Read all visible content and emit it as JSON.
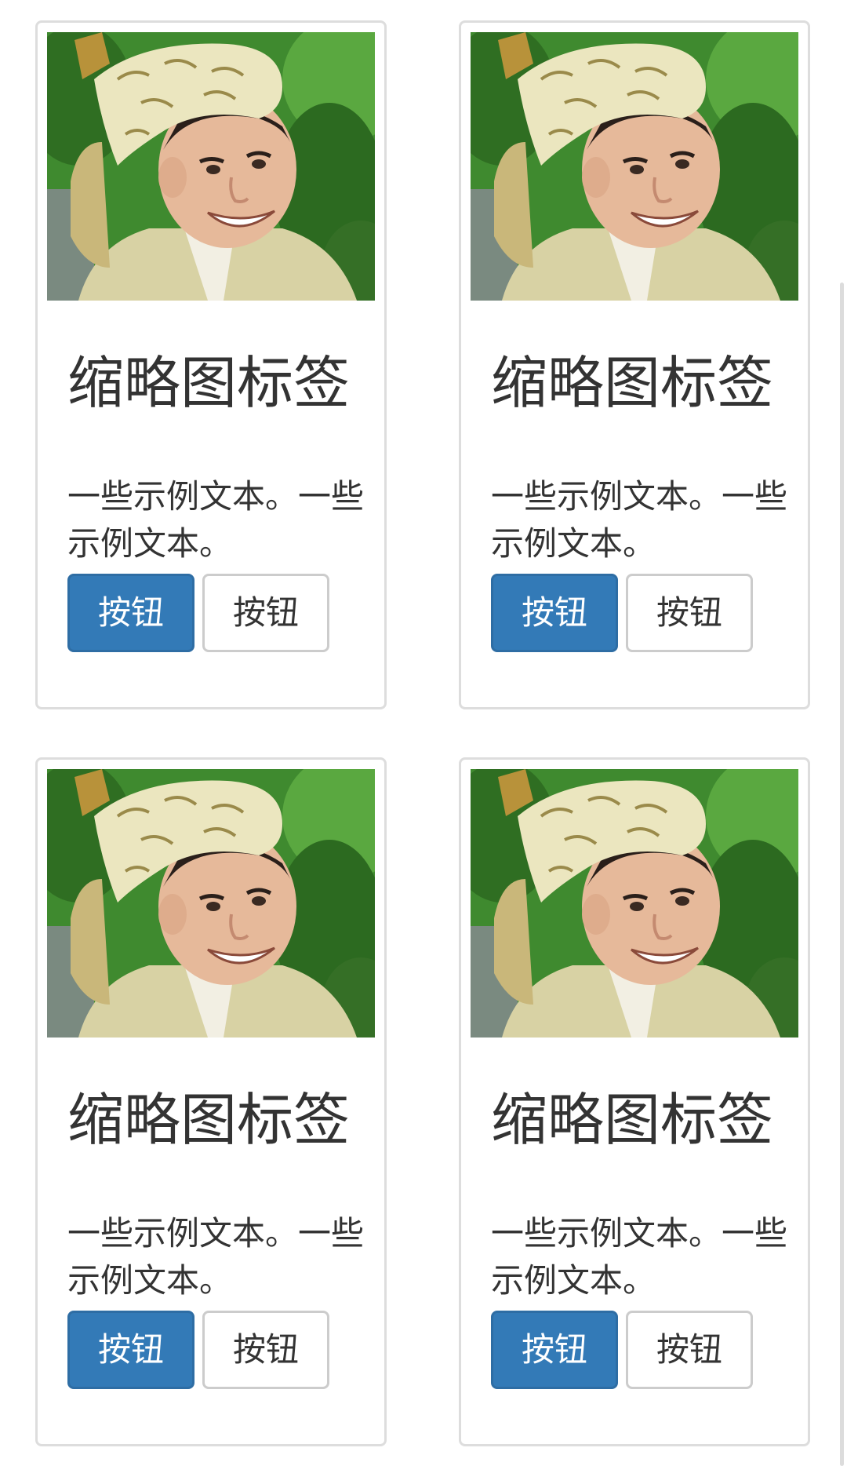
{
  "cards": [
    {
      "image_alt": "smiling man in embroidered cream hat, green foliage background",
      "title": "缩略图标签",
      "text": "一些示例文本。一些示例文本。",
      "primary_button": "按钮",
      "default_button": "按钮"
    },
    {
      "image_alt": "smiling man in embroidered cream hat, green foliage background",
      "title": "缩略图标签",
      "text": "一些示例文本。一些示例文本。",
      "primary_button": "按钮",
      "default_button": "按钮"
    },
    {
      "image_alt": "smiling man in embroidered cream hat, green foliage background",
      "title": "缩略图标签",
      "text": "一些示例文本。一些示例文本。",
      "primary_button": "按钮",
      "default_button": "按钮"
    },
    {
      "image_alt": "smiling man in embroidered cream hat, green foliage background",
      "title": "缩略图标签",
      "text": "一些示例文本。一些示例文本。",
      "primary_button": "按钮",
      "default_button": "按钮"
    }
  ],
  "colors": {
    "primary_button": "#337ab7",
    "card_border": "#dddddd",
    "text": "#333333"
  }
}
